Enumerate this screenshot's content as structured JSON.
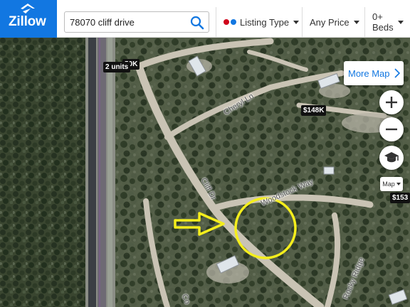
{
  "brand": {
    "name": "Zillow",
    "color": "#1277e1"
  },
  "search": {
    "value": "78070 cliff drive",
    "icon": "search-icon"
  },
  "filters": [
    {
      "label": "Listing Type",
      "dot_colors": [
        "#d0021b",
        "#1277e1"
      ]
    },
    {
      "label": "Any Price"
    },
    {
      "label": "0+ Beds"
    }
  ],
  "map": {
    "more_map_label": "More Map",
    "map_type_label": "Map",
    "controls": [
      "zoom-in-icon",
      "zoom-out-icon",
      "graduation-cap-icon"
    ],
    "cluster_label": "2 units",
    "price_tags": [
      "50K",
      "$148K",
      "$153"
    ],
    "road_labels": [
      "Cheryl Ln",
      "Cliff Dr",
      "Woodstock Way",
      "Rocky Ridge",
      "Co"
    ],
    "annotation_colors": {
      "arrow": "#f4ee1c",
      "circle": "#f4ee1c"
    }
  }
}
